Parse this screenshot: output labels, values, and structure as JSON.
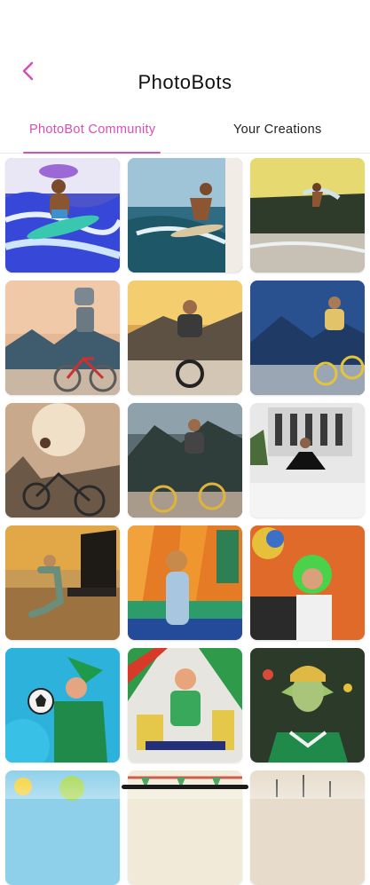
{
  "header": {
    "title": "PhotoBots",
    "back_icon": "chevron-left-icon"
  },
  "tabs": [
    {
      "label": "PhotoBot Community",
      "active": true
    },
    {
      "label": "Your Creations",
      "active": false
    }
  ],
  "colors": {
    "accent": "#d64fb7",
    "text": "#111111",
    "background": "#ffffff"
  },
  "gallery": {
    "items": [
      "surfer-on-turquoise-board",
      "surfer-riding-wave",
      "surfer-on-dark-wave",
      "robot-riding-bicycle",
      "man-cycling-at-sunset",
      "man-cycling-yellow-bike-mountains",
      "cyclist-in-misty-forest",
      "man-on-yellow-bicycle",
      "dancer-before-building",
      "mermaid-at-piano",
      "singer-on-orange-stage",
      "green-haired-figure-with-globe",
      "elf-holding-soccer-ball",
      "kid-in-green-soccer-kit",
      "elf-in-green-jersey",
      "partial-tile-1",
      "partial-tile-2",
      "partial-tile-3"
    ]
  }
}
